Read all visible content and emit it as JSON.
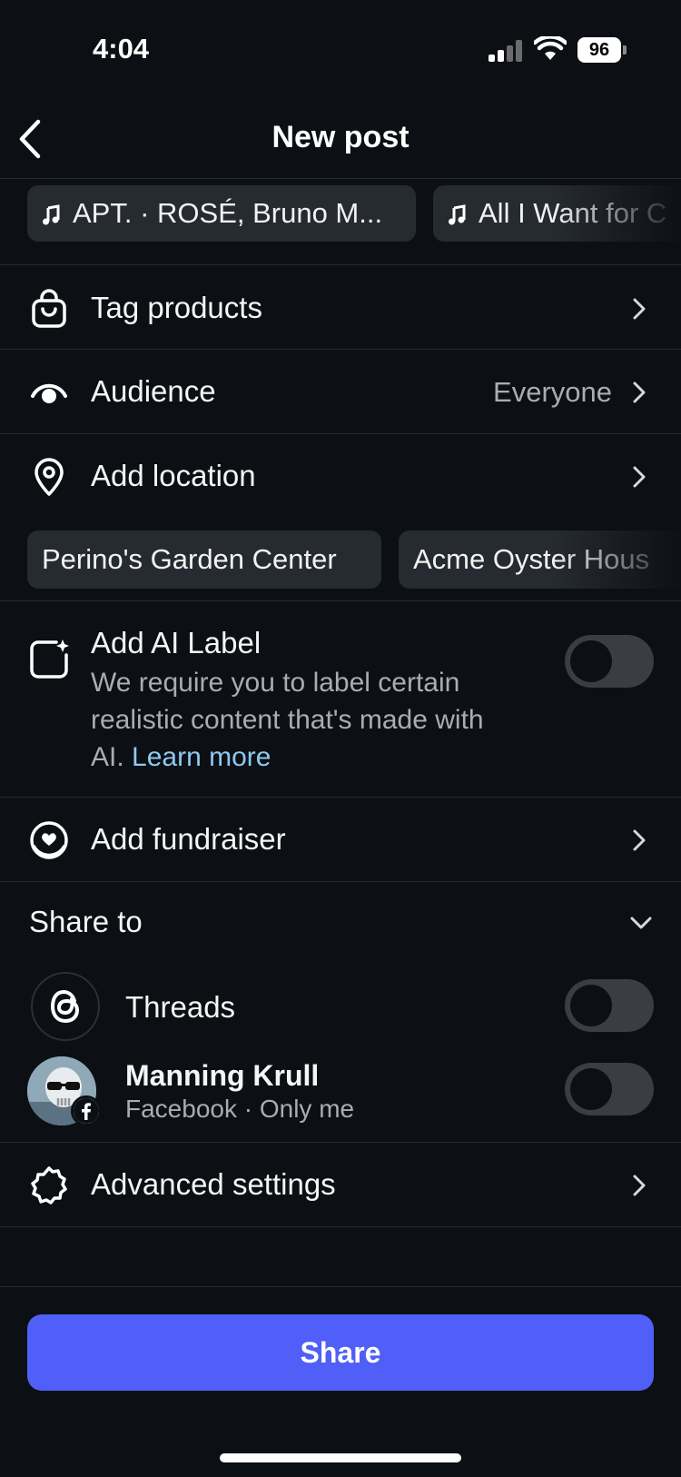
{
  "status_bar": {
    "time": "4:04",
    "battery": "96"
  },
  "nav": {
    "title": "New post"
  },
  "music_chips": [
    {
      "label": "APT. · ROSÉ, Bruno M..."
    },
    {
      "label": "All I Want for C"
    }
  ],
  "rows": {
    "tag_products": {
      "label": "Tag products"
    },
    "audience": {
      "label": "Audience",
      "value": "Everyone"
    },
    "add_location": {
      "label": "Add location"
    },
    "add_fundraiser": {
      "label": "Add fundraiser"
    },
    "advanced_settings": {
      "label": "Advanced settings"
    }
  },
  "location_chips": [
    {
      "label": "Perino's Garden Center"
    },
    {
      "label": "Acme Oyster Hous"
    }
  ],
  "ai_label": {
    "title": "Add AI Label",
    "description": "We require you to label certain realistic content that's made with AI.",
    "link": "Learn more",
    "enabled": false
  },
  "share_to": {
    "label": "Share to",
    "threads": {
      "label": "Threads",
      "enabled": false
    },
    "profile": {
      "name": "Manning Krull",
      "sub": "Facebook · Only me",
      "enabled": false
    }
  },
  "share_button": {
    "label": "Share"
  },
  "colors": {
    "background": "#0c0f14",
    "accent": "#4f5ff7",
    "link": "#8ec9f0"
  }
}
